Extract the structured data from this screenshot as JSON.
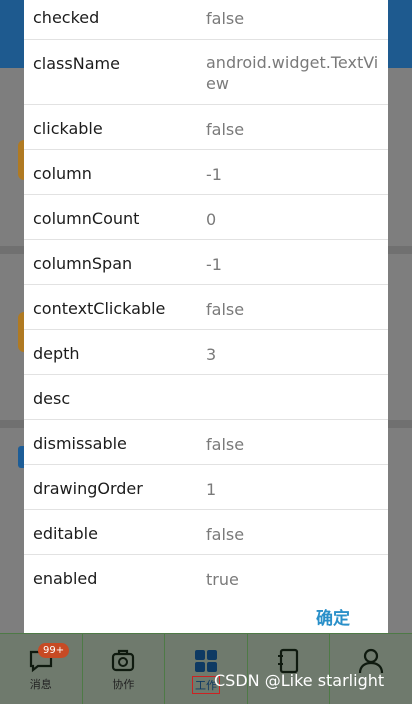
{
  "dialog": {
    "rows": [
      {
        "key": "checked",
        "value": "false"
      },
      {
        "key": "className",
        "value": "android.widget.TextView"
      },
      {
        "key": "clickable",
        "value": "false"
      },
      {
        "key": "column",
        "value": "-1"
      },
      {
        "key": "columnCount",
        "value": "0"
      },
      {
        "key": "columnSpan",
        "value": "-1"
      },
      {
        "key": "contextClickable",
        "value": "false"
      },
      {
        "key": "depth",
        "value": "3"
      },
      {
        "key": "desc",
        "value": ""
      },
      {
        "key": "dismissable",
        "value": "false"
      },
      {
        "key": "drawingOrder",
        "value": "1"
      },
      {
        "key": "editable",
        "value": "false"
      },
      {
        "key": "enabled",
        "value": "true"
      }
    ],
    "confirm_label": "确定"
  },
  "bottom_nav": {
    "items": [
      {
        "label": "消息",
        "icon": "message-icon"
      },
      {
        "label": "协作",
        "icon": "collaboration-icon"
      },
      {
        "label": "工作",
        "icon": "grid-icon"
      },
      {
        "label": "",
        "icon": "contacts-icon"
      },
      {
        "label": "",
        "icon": "profile-icon"
      }
    ],
    "badge": "99+"
  },
  "watermark": "CSDN @Like starlight"
}
